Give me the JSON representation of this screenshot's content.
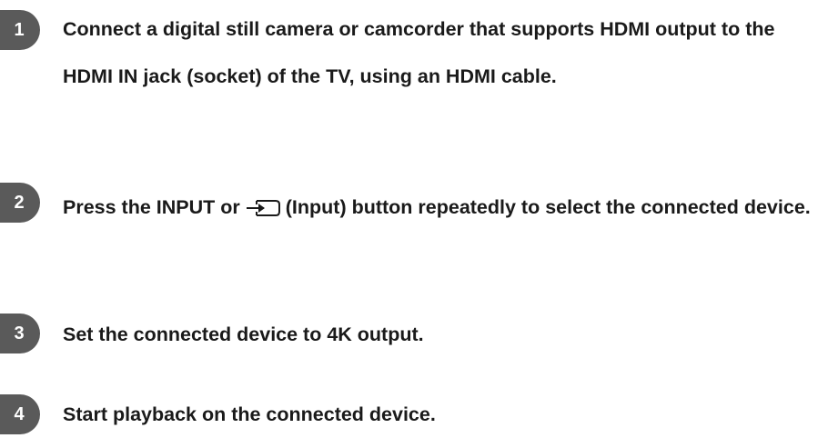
{
  "steps": [
    {
      "number": "1",
      "text": "Connect a digital still camera or camcorder that supports HDMI output to the HDMI IN jack (socket) of the TV, using an HDMI cable."
    },
    {
      "number": "2",
      "text_before_icon": "Press the INPUT or",
      "icon": "input-icon",
      "text_after_icon": "(Input) button repeatedly to select the connected device."
    },
    {
      "number": "3",
      "text": "Set the connected device to 4K output."
    },
    {
      "number": "4",
      "text": "Start playback on the connected device."
    }
  ],
  "colors": {
    "badge_background": "#5a5a5a",
    "badge_text": "#ffffff",
    "body_text": "#1a1a1a"
  }
}
